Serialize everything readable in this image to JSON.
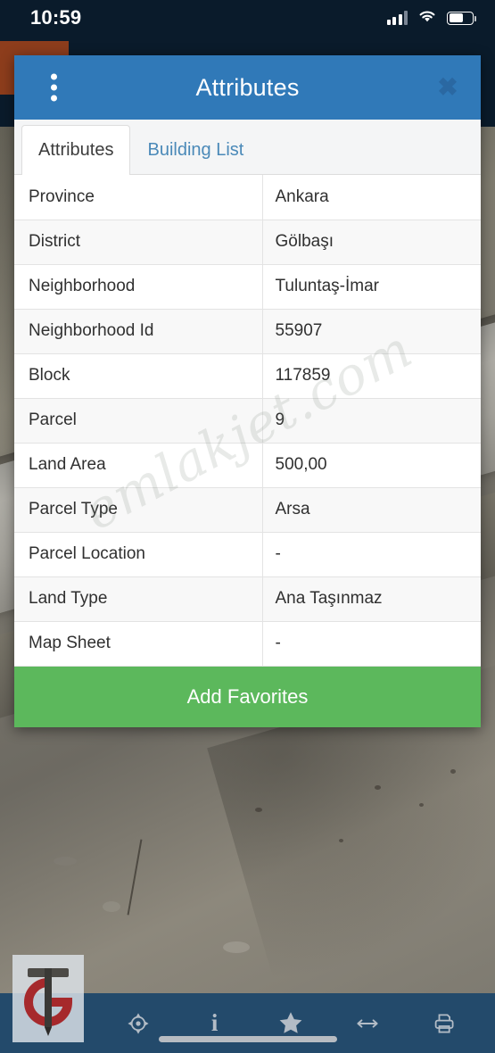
{
  "status_bar": {
    "time": "10:59",
    "icons": [
      "signal-bars-icon",
      "wifi-icon",
      "battery-icon"
    ]
  },
  "dialog": {
    "title": "Attributes",
    "menu_icon": "kebab-menu-icon",
    "close_icon": "close-icon",
    "close_glyph": "✖",
    "tabs": [
      {
        "label": "Attributes",
        "active": true
      },
      {
        "label": "Building List",
        "active": false
      }
    ],
    "rows": [
      {
        "key": "Province",
        "value": "Ankara"
      },
      {
        "key": "District",
        "value": "Gölbaşı"
      },
      {
        "key": "Neighborhood",
        "value": "Tuluntaş-İmar"
      },
      {
        "key": "Neighborhood Id",
        "value": "55907"
      },
      {
        "key": "Block",
        "value": "117859"
      },
      {
        "key": "Parcel",
        "value": "9"
      },
      {
        "key": "Land Area",
        "value": "500,00"
      },
      {
        "key": "Parcel Type",
        "value": "Arsa"
      },
      {
        "key": "Parcel Location",
        "value": "-"
      },
      {
        "key": "Land Type",
        "value": "Ana Taşınmaz"
      },
      {
        "key": "Map Sheet",
        "value": "-"
      }
    ],
    "favorites_button": "Add Favorites",
    "watermark": "emlakjet.com"
  },
  "bottom_bar": {
    "icons": [
      {
        "name": "locate-crosshair-icon"
      },
      {
        "name": "info-icon",
        "glyph": "i"
      },
      {
        "name": "star-favorite-icon"
      },
      {
        "name": "measure-distance-icon"
      },
      {
        "name": "print-icon"
      }
    ],
    "home_indicator": "home-indicator"
  },
  "branding": {
    "corner_logo": "tg-monogram-logo"
  },
  "colors": {
    "header_blue": "#3079b8",
    "status_bar_dark": "#0a1b2b",
    "favorites_green": "#5cb85c",
    "bottom_bar_blue": "#234a6b",
    "tab_link_blue": "#4a89b8",
    "accent_orange": "#8d3d1c"
  }
}
